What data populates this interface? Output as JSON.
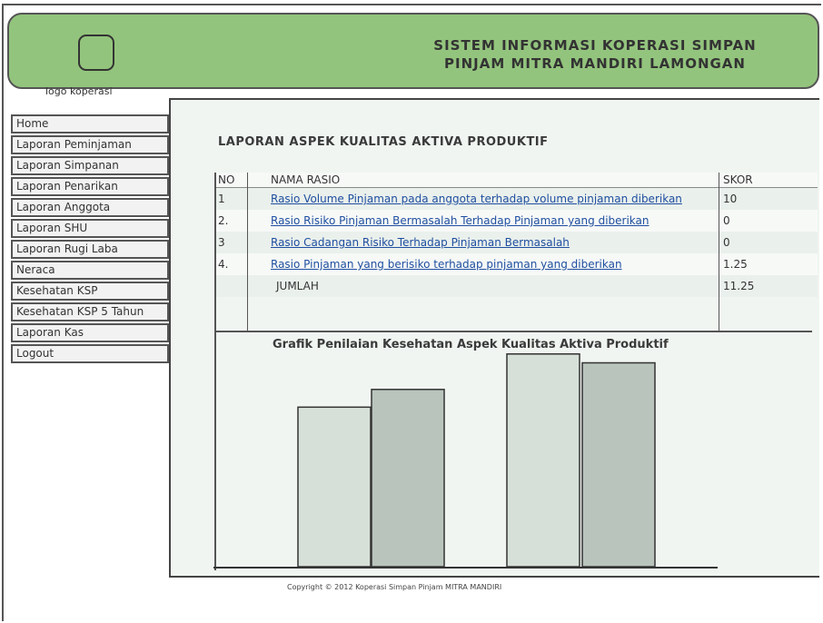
{
  "header": {
    "logo_text": "logo koperasi",
    "title_line1": "SISTEM INFORMASI KOPERASI SIMPAN",
    "title_line2": "PINJAM MITRA MANDIRI LAMONGAN"
  },
  "sidebar": {
    "items": [
      {
        "label": "Home"
      },
      {
        "label": "Laporan Peminjaman"
      },
      {
        "label": "Laporan Simpanan"
      },
      {
        "label": "Laporan Penarikan"
      },
      {
        "label": "Laporan Anggota"
      },
      {
        "label": "Laporan SHU"
      },
      {
        "label": "Laporan Rugi Laba"
      },
      {
        "label": "Neraca"
      },
      {
        "label": "Kesehatan KSP"
      },
      {
        "label": "Kesehatan KSP 5 Tahun"
      },
      {
        "label": "Laporan Kas"
      },
      {
        "label": "Logout"
      }
    ]
  },
  "report": {
    "title": "LAPORAN ASPEK KUALITAS AKTIVA PRODUKTIF",
    "columns": {
      "no": "NO",
      "nama": "NAMA RASIO",
      "skor": "SKOR"
    },
    "rows": [
      {
        "no": "1",
        "nama": "Rasio Volume Pinjaman pada anggota terhadap volume pinjaman diberikan",
        "skor": "10"
      },
      {
        "no": "2.",
        "nama": "Rasio Risiko Pinjaman Bermasalah Terhadap Pinjaman yang diberikan",
        "skor": "0"
      },
      {
        "no": "3",
        "nama": "Rasio Cadangan Risiko  Terhadap Pinjaman Bermasalah",
        "skor": "0"
      },
      {
        "no": "4.",
        "nama": "Rasio Pinjaman yang berisiko terhadap pinjaman yang diberikan",
        "skor": "1.25"
      }
    ],
    "total": {
      "label": "JUMLAH",
      "skor": "11.25"
    }
  },
  "chart_data": {
    "type": "bar",
    "title": "Grafik Penilaian Kesehatan Aspek Kualitas Aktiva Produktif",
    "series": [
      {
        "values": [
          0.72,
          0.8,
          0.96,
          0.92
        ]
      }
    ],
    "ylim": [
      0,
      1
    ],
    "grid": false,
    "colors": [
      "#d6e0d9",
      "#b9c4bd",
      "#d6e0d9",
      "#b9c4bd"
    ]
  },
  "footer": {
    "copyright": "Copyright © 2012 Koperasi Simpan Pinjam MITRA MANDIRI"
  }
}
